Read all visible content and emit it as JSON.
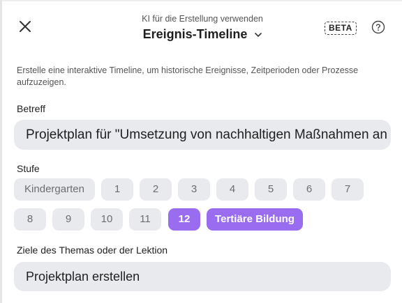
{
  "header": {
    "pre_title": "KI für die Erstellung verwenden",
    "title": "Ereignis-Timeline",
    "beta_label": "BETA"
  },
  "icons": {
    "close": "close-icon",
    "dropdown": "chevron-down-icon",
    "help": "question-icon"
  },
  "description": "Erstelle eine interaktive Timeline, um historische Ereignisse, Zeitperioden oder Prozesse aufzuzeigen.",
  "subject": {
    "label": "Betreff",
    "value": "Projektplan für \"Umsetzung von nachhaltigen Maßnahmen an"
  },
  "level": {
    "label": "Stufe",
    "options": [
      "Kindergarten",
      "1",
      "2",
      "3",
      "4",
      "5",
      "6",
      "7",
      "8",
      "9",
      "10",
      "11",
      "12",
      "Tertiäre Bildung"
    ],
    "selected": [
      "12",
      "Tertiäre Bildung"
    ]
  },
  "goals": {
    "label": "Ziele des Themas oder der Lektion",
    "value": "Projektplan erstellen"
  },
  "colors": {
    "accent": "#9a6cf0",
    "chip_bg": "#e8eaee",
    "input_bg": "#e8eaee"
  }
}
